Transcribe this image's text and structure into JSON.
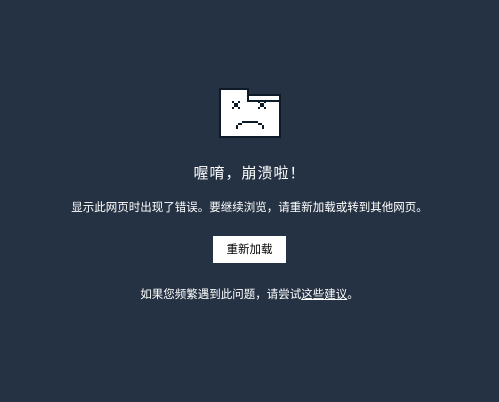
{
  "page": {
    "background_color": "#253243"
  },
  "crash": {
    "icon": "sad-folder-icon",
    "headline": "喔唷，崩溃啦！",
    "message": "显示此网页时出现了错误。要继续浏览，请重新加载或转到其他网页。",
    "reload_label": "重新加载",
    "hint_prefix": "如果您频繁遇到此问题，请尝试",
    "hint_link": "这些建议",
    "hint_suffix": "。"
  }
}
